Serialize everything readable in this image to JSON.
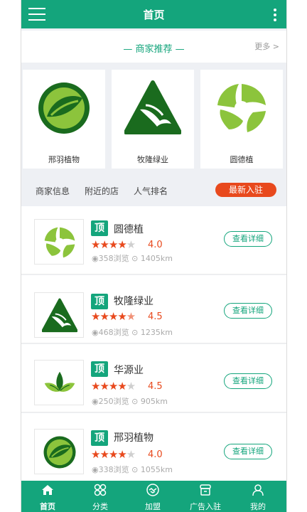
{
  "header": {
    "title": "首页"
  },
  "recommend": {
    "title": "— 商家推荐 —",
    "more": "更多 >"
  },
  "cards": [
    {
      "name": "邢羽植物"
    },
    {
      "name": "牧隆绿业"
    },
    {
      "name": "圆德植"
    }
  ],
  "tabs": {
    "info": "商家信息",
    "nearby": "附近的店",
    "popular": "人气排名",
    "join": "最新入驻"
  },
  "badge_label": "顶",
  "detail_label": "查看详细",
  "list": [
    {
      "name": "圆德植",
      "rating": "4.0",
      "views": "358浏览",
      "distance": "1405km"
    },
    {
      "name": "牧隆绿业",
      "rating": "4.5",
      "views": "468浏览",
      "distance": "1235km"
    },
    {
      "name": "华源业",
      "rating": "4.5",
      "views": "250浏览",
      "distance": "905km"
    },
    {
      "name": "邢羽植物",
      "rating": "4.0",
      "views": "338浏览",
      "distance": "1055km"
    }
  ],
  "nav": [
    {
      "label": "首页",
      "icon": "home-icon"
    },
    {
      "label": "分类",
      "icon": "category-icon"
    },
    {
      "label": "加盟",
      "icon": "handshake-icon"
    },
    {
      "label": "广告入驻",
      "icon": "store-icon"
    },
    {
      "label": "我的",
      "icon": "user-icon"
    }
  ],
  "colors": {
    "brand": "#14a57c",
    "accent": "#e8491d",
    "logo_green": "#1a6b1e",
    "logo_lime": "#8cc43c"
  }
}
